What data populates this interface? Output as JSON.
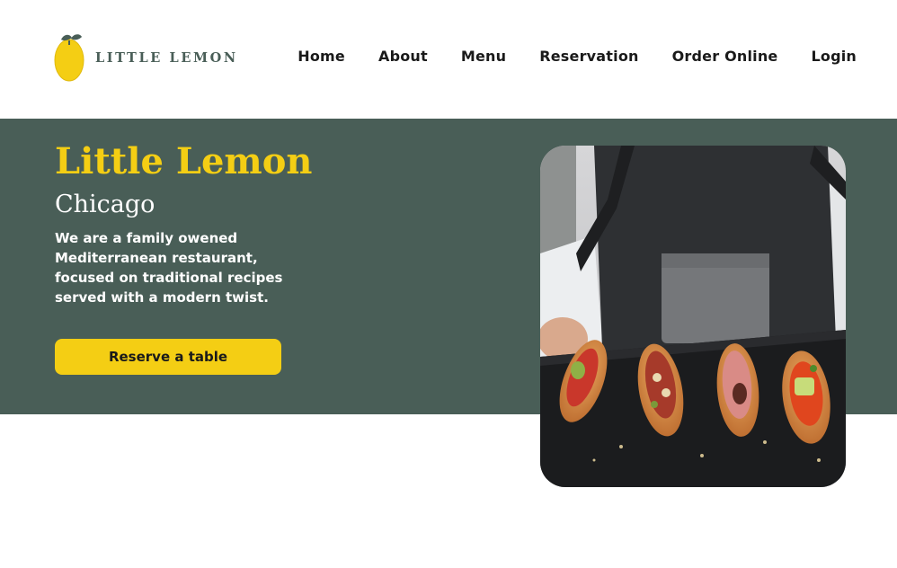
{
  "brand": {
    "logo_text": "LITTLE LEMON",
    "icon": "lemon-icon",
    "colors": {
      "primary": "#495E57",
      "accent": "#F4CE14"
    }
  },
  "nav": {
    "items": [
      {
        "label": "Home"
      },
      {
        "label": "About"
      },
      {
        "label": "Menu"
      },
      {
        "label": "Reservation"
      },
      {
        "label": "Order Online"
      },
      {
        "label": "Login"
      }
    ]
  },
  "hero": {
    "title": "Little Lemon",
    "subtitle": "Chicago",
    "description": "We are a family owened Mediterranean restaurant, focused on traditional recipes served with a modern twist.",
    "cta_label": "Reserve a table"
  }
}
